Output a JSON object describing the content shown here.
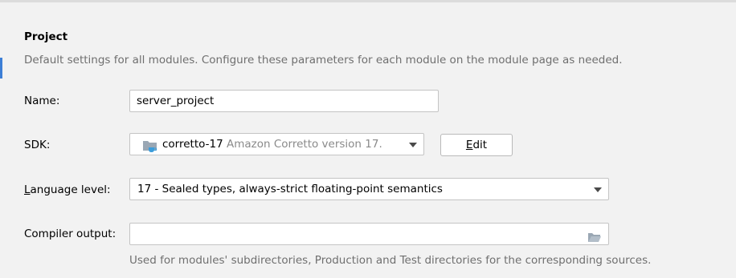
{
  "section": {
    "title": "Project",
    "description": "Default settings for all modules. Configure these parameters for each module on the module page as needed."
  },
  "name": {
    "label": "Name:",
    "value": "server_project"
  },
  "sdk": {
    "label": "SDK:",
    "selected_name": "corretto-17",
    "selected_detail": "Amazon Corretto version 17.",
    "icon": "folder-with-cup-icon",
    "edit_button_label": "Edit",
    "edit_button_mnemonic": "E",
    "edit_button_rest": "dit"
  },
  "language_level": {
    "label": "Language level:",
    "label_mnemonic": "L",
    "label_rest": "anguage level:",
    "value": "17 - Sealed types, always-strict floating-point semantics"
  },
  "compiler_output": {
    "label": "Compiler output:",
    "value": "",
    "hint": "Used for modules' subdirectories, Production and Test directories for the corresponding sources.",
    "icon": "folder-open-icon"
  },
  "colors": {
    "background": "#f2f2f2",
    "accent": "#3d7fd6",
    "muted_text": "#6f6f6f",
    "field_border": "#c4c4c4"
  }
}
